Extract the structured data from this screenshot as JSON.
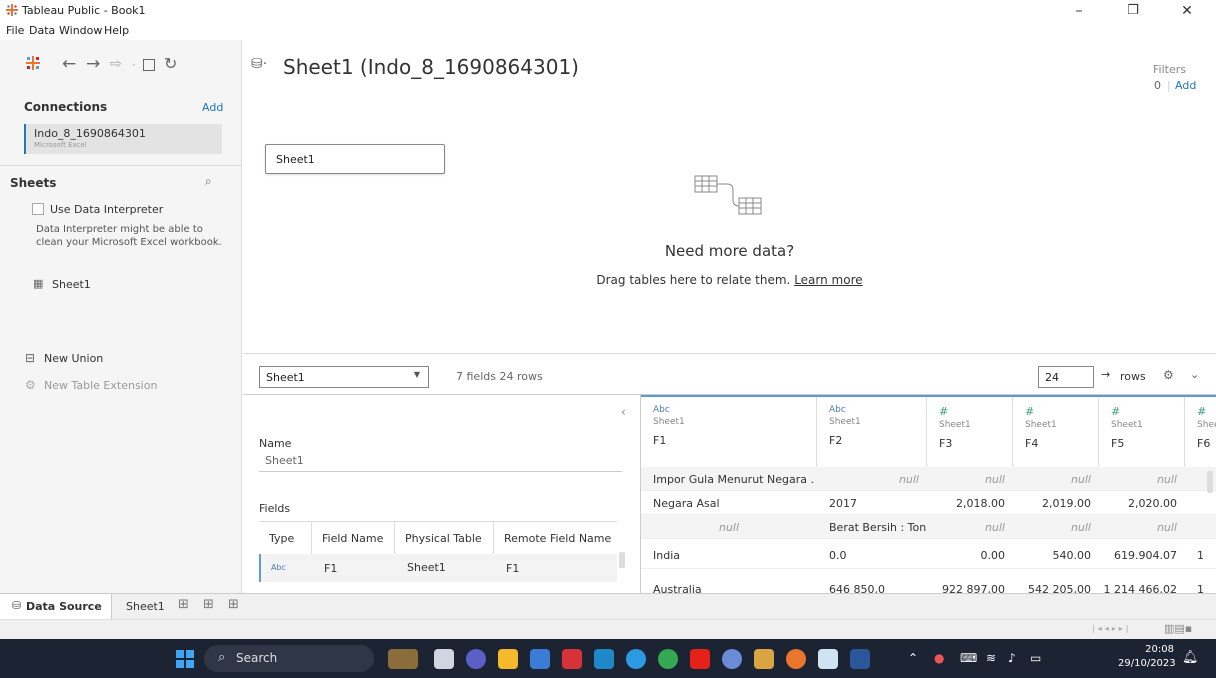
{
  "window": {
    "title": "Tableau Public - Book1",
    "controls": [
      "–",
      "❐",
      "✕"
    ]
  },
  "menu": [
    "File",
    "Data",
    "Window",
    "Help"
  ],
  "left": {
    "connections_title": "Connections",
    "add_label": "Add",
    "connection": {
      "name": "Indo_8_1690864301",
      "type": "Microsoft Excel"
    },
    "sheets_title": "Sheets",
    "interpreter_label": "Use Data Interpreter",
    "interpreter_note": "Data Interpreter might be able to clean your Microsoft Excel workbook.",
    "sheet_item": "Sheet1",
    "new_union": "New Union",
    "new_table_extension": "New Table Extension"
  },
  "canvas": {
    "title": "Sheet1 (Indo_8_1690864301)",
    "filters_label": "Filters",
    "filters_count": "0",
    "filters_add": "Add",
    "table_box": "Sheet1",
    "need_more": "Need more data?",
    "drag_hint": "Drag tables here to relate them.",
    "learn_more": "Learn more"
  },
  "gridbar": {
    "sheet_select": "Sheet1",
    "summary": "7 fields 24 rows",
    "rows_value": "24",
    "rows_label": "rows"
  },
  "meta": {
    "name_label": "Name",
    "name_value": "Sheet1",
    "fields_label": "Fields",
    "headers": [
      "Type",
      "Field Name",
      "Physical Table",
      "Remote Field Name"
    ],
    "row": {
      "type": "Abc",
      "field": "F1",
      "table": "Sheet1",
      "remote": "F1"
    }
  },
  "grid": {
    "columns": [
      {
        "type": "Abc",
        "source": "Sheet1",
        "field": "F1"
      },
      {
        "type": "Abc",
        "source": "Sheet1",
        "field": "F2"
      },
      {
        "type": "#",
        "source": "Sheet1",
        "field": "F3"
      },
      {
        "type": "#",
        "source": "Sheet1",
        "field": "F4"
      },
      {
        "type": "#",
        "source": "Sheet1",
        "field": "F5"
      },
      {
        "type": "#",
        "source": "Shee",
        "field": "F6"
      }
    ],
    "rows": [
      [
        "Impor Gula Menurut Negara ...",
        "null",
        "null",
        "null",
        "null",
        ""
      ],
      [
        "Negara Asal",
        "2017",
        "2,018.00",
        "2,019.00",
        "2,020.00",
        ""
      ],
      [
        "null",
        "Berat Bersih : Ton",
        "null",
        "null",
        "null",
        ""
      ],
      [
        "India",
        "0.0",
        "0.00",
        "540.00",
        "619.904.07",
        "1"
      ],
      [
        "Australia",
        "646 850,0",
        "922 897,00",
        "542 205,00",
        "1 214 466,02",
        "1"
      ]
    ]
  },
  "tabs": {
    "data_source": "Data Source",
    "sheet1": "Sheet1"
  },
  "taskbar": {
    "search": "Search",
    "time": "20:08",
    "date": "29/10/2023"
  }
}
